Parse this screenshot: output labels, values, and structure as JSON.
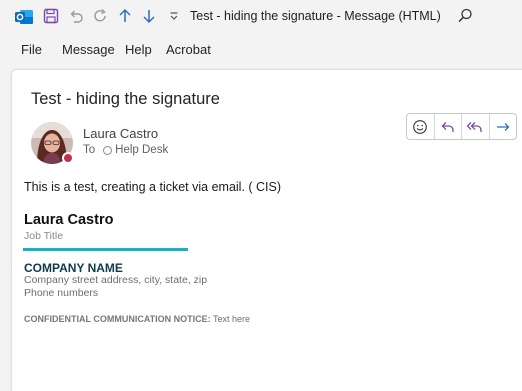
{
  "window": {
    "title": "Test - hiding the signature  -  Message (HTML)"
  },
  "menu": {
    "items": [
      "File",
      "Message",
      "Help",
      "Acrobat"
    ]
  },
  "message": {
    "subject": "Test - hiding the signature",
    "sender": "Laura Castro",
    "to_label": "To",
    "recipient": "Help Desk",
    "body": "This is a test, creating a ticket via email. ( CIS)"
  },
  "signature": {
    "name": "Laura Castro",
    "job_title": "Job Title",
    "company": "COMPANY NAME",
    "address": "Company street address, city, state, zip",
    "phone": "Phone numbers",
    "notice_label": "CONFIDENTIAL COMMUNICATION NOTICE:",
    "notice_text": " Text here",
    "accent_color": "#16b3c8"
  },
  "icons": {
    "outlook": "outlook-logo-icon",
    "save": "save-icon",
    "undo": "undo-icon",
    "redo": "redo-icon",
    "previous": "arrow-up-icon",
    "next": "arrow-down-icon",
    "customize": "customize-toolbar-icon",
    "search": "search-icon",
    "emoji": "emoji-icon",
    "reply": "reply-icon",
    "reply_all": "reply-all-icon",
    "forward": "forward-icon"
  },
  "colors": {
    "presence": "#c4314b",
    "brand": "#0f6cbd"
  }
}
